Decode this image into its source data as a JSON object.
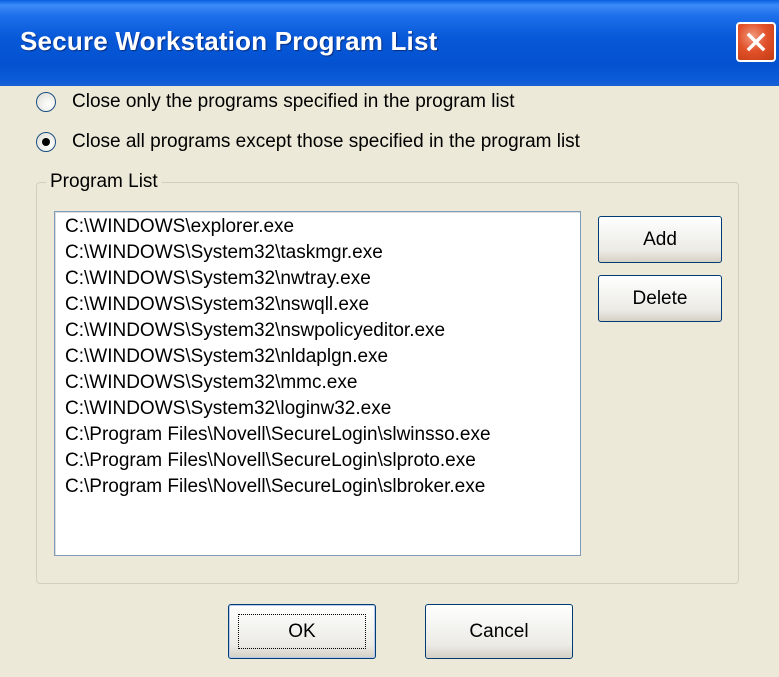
{
  "window": {
    "title": "Secure Workstation Program List"
  },
  "options": [
    {
      "label": "Close only the programs specified in the program list",
      "selected": false
    },
    {
      "label": "Close all programs except those specified in the program list",
      "selected": true
    }
  ],
  "program_list": {
    "legend": "Program List",
    "items": [
      "C:\\WINDOWS\\explorer.exe",
      "C:\\WINDOWS\\System32\\taskmgr.exe",
      "C:\\WINDOWS\\System32\\nwtray.exe",
      "C:\\WINDOWS\\System32\\nswqll.exe",
      "C:\\WINDOWS\\System32\\nswpolicyeditor.exe",
      "C:\\WINDOWS\\System32\\nldaplgn.exe",
      "C:\\WINDOWS\\System32\\mmc.exe",
      "C:\\WINDOWS\\System32\\loginw32.exe",
      "C:\\Program Files\\Novell\\SecureLogin\\slwinsso.exe",
      "C:\\Program Files\\Novell\\SecureLogin\\slproto.exe",
      "C:\\Program Files\\Novell\\SecureLogin\\slbroker.exe"
    ],
    "add_label": "Add",
    "delete_label": "Delete"
  },
  "footer": {
    "ok_label": "OK",
    "cancel_label": "Cancel"
  },
  "colors": {
    "titlebar": "#0758D8",
    "close_button": "#E2522B",
    "dialog_background": "#ECE9D8"
  },
  "icons": {
    "close": "close-icon"
  }
}
